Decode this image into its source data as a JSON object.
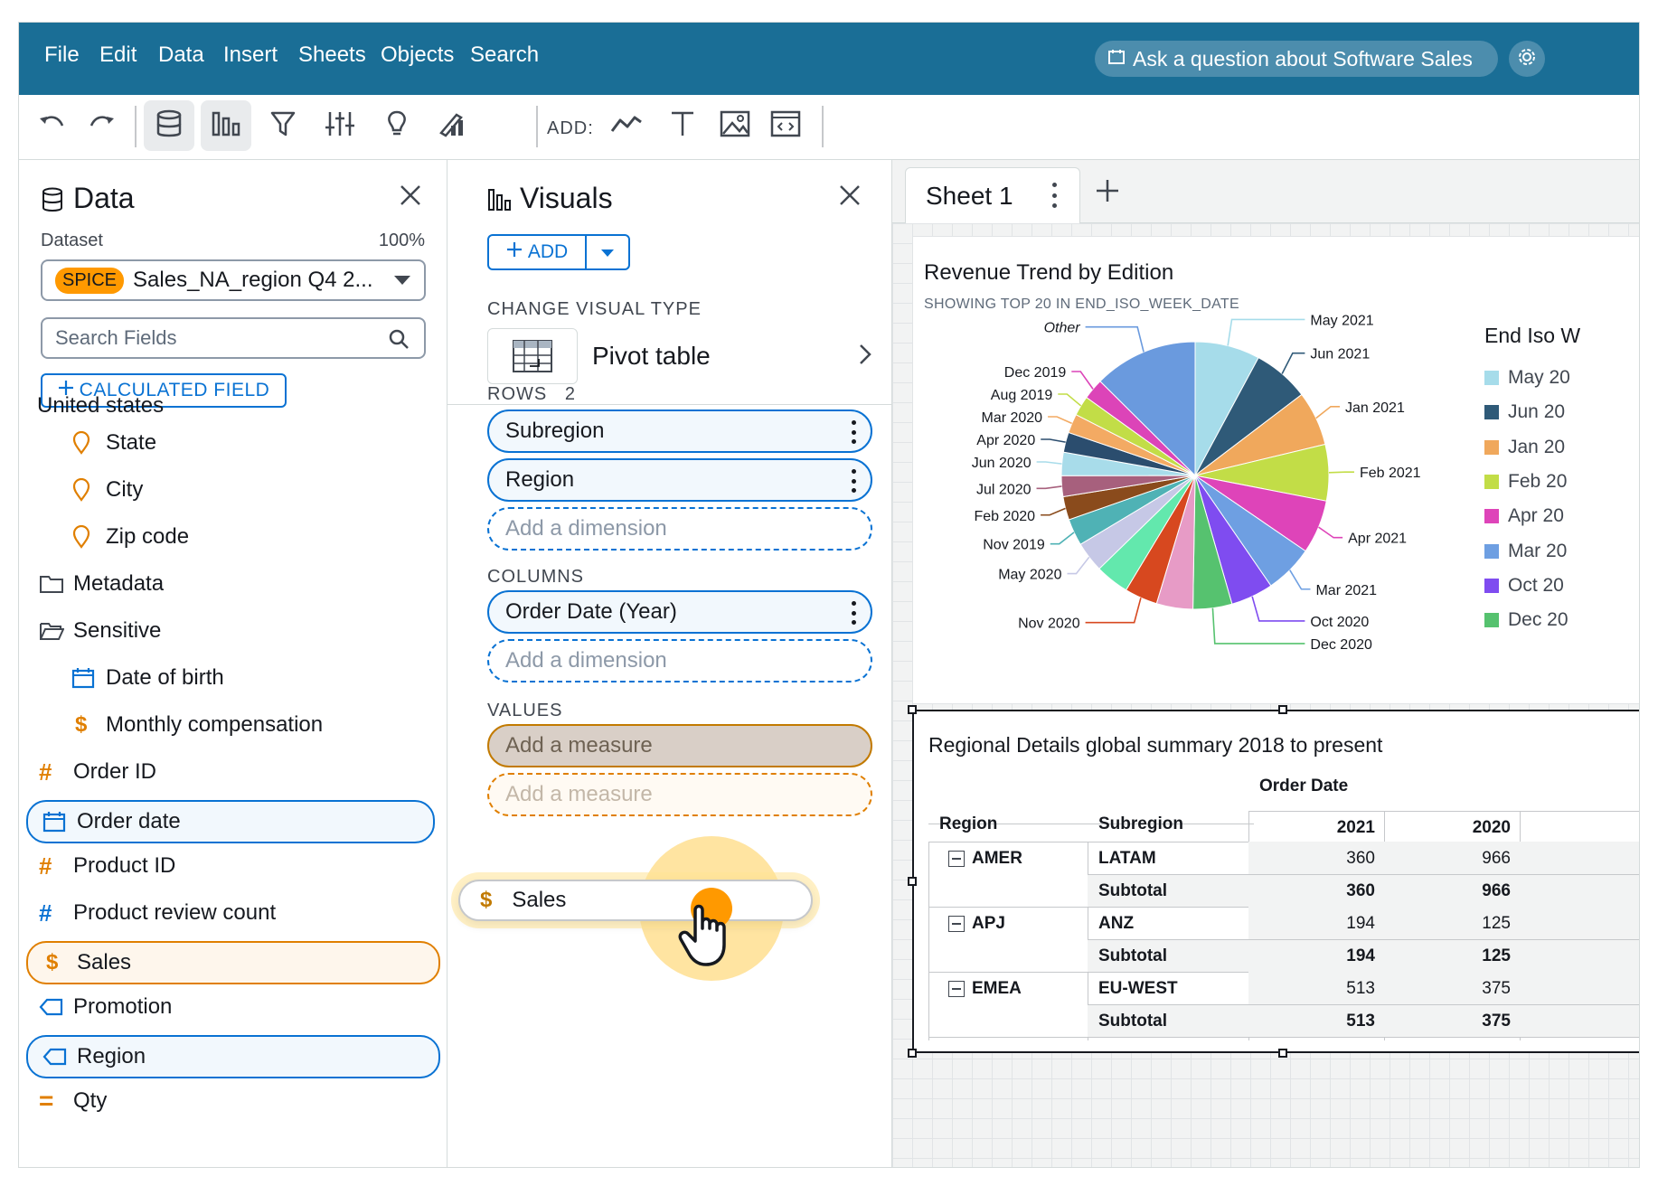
{
  "menu": [
    "File",
    "Edit",
    "Data",
    "Insert",
    "Sheets",
    "Objects",
    "Search"
  ],
  "ask_bar": {
    "text": "Ask a question about Software Sales"
  },
  "toolbar": {
    "add_label": "ADD:"
  },
  "data_panel": {
    "title": "Data",
    "dataset_label": "Dataset",
    "dataset_percent": "100%",
    "spice_badge": "SPICE",
    "dataset_name": "Sales_NA_region Q4 2...",
    "search_placeholder": "Search Fields",
    "calculated_field_label": "CALCULATED FIELD",
    "groups": {
      "united_states": "United states",
      "metadata": "Metadata",
      "sensitive": "Sensitive"
    },
    "fields": {
      "state": "State",
      "city": "City",
      "zip": "Zip code",
      "dob": "Date of birth",
      "monthly_comp": "Monthly compensation",
      "order_id": "Order ID",
      "order_date": "Order date",
      "product_id": "Product ID",
      "product_review_count": "Product review count",
      "sales": "Sales",
      "promotion": "Promotion",
      "region": "Region",
      "qty": "Qty"
    }
  },
  "visuals_panel": {
    "title": "Visuals",
    "add_label": "ADD",
    "change_type_label": "CHANGE VISUAL TYPE",
    "visual_type": "Pivot table",
    "rows_label": "ROWS",
    "rows_count": "2",
    "rows": [
      "Subregion",
      "Region"
    ],
    "add_dimension": "Add a dimension",
    "columns_label": "COLUMNS",
    "columns": [
      "Order Date (Year)"
    ],
    "values_label": "VALUES",
    "add_measure": "Add a measure",
    "drag_field": "Sales",
    "drag_symbol": "$"
  },
  "sheet": {
    "tab_name": "Sheet 1"
  },
  "pie_visual": {
    "title": "Revenue Trend by Edition",
    "subtitle": "SHOWING TOP 20 IN END_ISO_WEEK_DATE",
    "legend_title": "End Iso W",
    "legend_items": [
      {
        "label": "May 20",
        "color": "#a6dcea"
      },
      {
        "label": "Jun 20",
        "color": "#2f5a78"
      },
      {
        "label": "Jan 20",
        "color": "#f0a85c"
      },
      {
        "label": "Feb 20",
        "color": "#c2dd47"
      },
      {
        "label": "Apr 20",
        "color": "#de44b9"
      },
      {
        "label": "Mar 20",
        "color": "#6e9fe2"
      },
      {
        "label": "Oct 20",
        "color": "#7f4cf0"
      },
      {
        "label": "Dec 20",
        "color": "#56c26f"
      }
    ]
  },
  "chart_data": {
    "type": "pie",
    "title": "Revenue Trend by Edition",
    "subtitle": "SHOWING TOP 20 IN END_ISO_WEEK_DATE",
    "legend_title": "End Iso W",
    "slices": [
      {
        "label": "May 2021",
        "value": 7.5,
        "color": "#a6dcea"
      },
      {
        "label": "Jun 2021",
        "value": 6.5,
        "color": "#2f5a78"
      },
      {
        "label": "Jan 2021",
        "value": 6.3,
        "color": "#f0a85c"
      },
      {
        "label": "Feb 2021",
        "value": 6.5,
        "color": "#c2dd47"
      },
      {
        "label": "Apr 2021",
        "value": 6.2,
        "color": "#de44b9"
      },
      {
        "label": "Mar 2021",
        "value": 5.6,
        "color": "#6e9fe2"
      },
      {
        "label": "Oct 2020",
        "value": 4.9,
        "color": "#7f4cf0"
      },
      {
        "label": "Dec 2020",
        "value": 4.5,
        "color": "#56c26f"
      },
      {
        "label": "",
        "value": 4.2,
        "color": "#e79bc6"
      },
      {
        "label": "Nov 2020",
        "value": 3.8,
        "color": "#d7481f"
      },
      {
        "label": "",
        "value": 3.9,
        "color": "#63e8ad"
      },
      {
        "label": "May 2020",
        "value": 3.5,
        "color": "#c6c8e6"
      },
      {
        "label": "Nov 2019",
        "value": 3.1,
        "color": "#4fb2b5"
      },
      {
        "label": "Feb 2020",
        "value": 2.7,
        "color": "#8a4b1c"
      },
      {
        "label": "Jul 2020",
        "value": 2.4,
        "color": "#a7607d"
      },
      {
        "label": "Jun 2020",
        "value": 2.7,
        "color": "#a8dcea"
      },
      {
        "label": "Apr 2020",
        "value": 2.3,
        "color": "#2b4d6e"
      },
      {
        "label": "Mar 2020",
        "value": 2.2,
        "color": "#f3aa63"
      },
      {
        "label": "Aug 2019",
        "value": 2.3,
        "color": "#c2dd47"
      },
      {
        "label": "Dec 2019",
        "value": 2.4,
        "color": "#dc44b8"
      },
      {
        "label": "Other",
        "value": 12.0,
        "color": "#6a9ade"
      }
    ]
  },
  "table_visual": {
    "title": "Regional Details global summary 2018 to present",
    "column_group": "Order Date",
    "headers": [
      "Region",
      "Subregion",
      "2021",
      "2020"
    ],
    "rows": [
      {
        "region": "AMER",
        "subregion": "LATAM",
        "y2021": "360",
        "y2020": "966",
        "subtotal_label": "Subtotal",
        "s2021": "360",
        "s2020": "966"
      },
      {
        "region": "APJ",
        "subregion": "ANZ",
        "y2021": "194",
        "y2020": "125",
        "subtotal_label": "Subtotal",
        "s2021": "194",
        "s2020": "125"
      },
      {
        "region": "EMEA",
        "subregion": "EU-WEST",
        "y2021": "513",
        "y2020": "375",
        "subtotal_label": "Subtotal",
        "s2021": "513",
        "s2020": "375"
      }
    ]
  },
  "colors": {
    "menubar": "#1a6e96",
    "accent_blue": "#0972d3",
    "accent_orange": "#ff9900"
  }
}
